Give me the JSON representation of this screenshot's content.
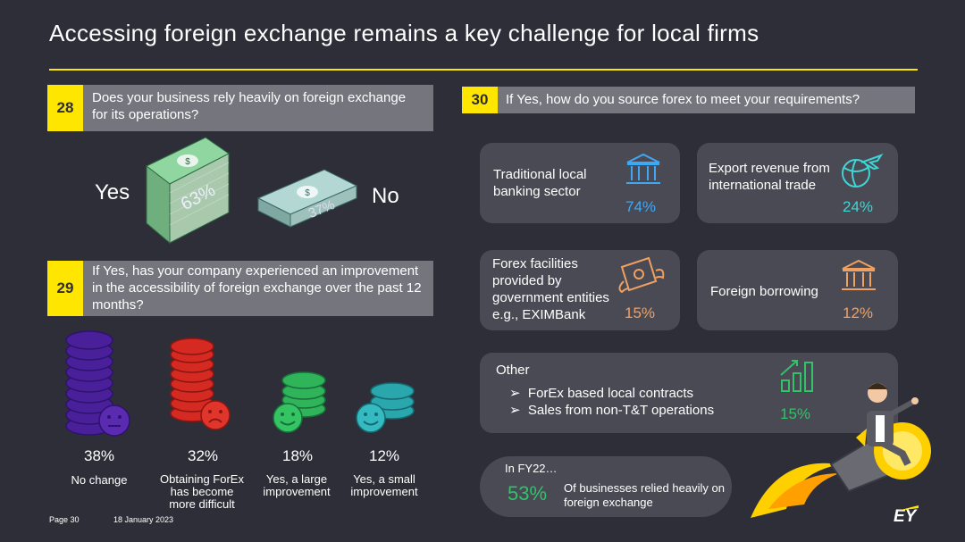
{
  "title": "Accessing foreign exchange remains a key challenge for local firms",
  "colors": {
    "background": "#2e2e38",
    "accent": "#ffe600",
    "bar": "#75757e",
    "card": "#4a4a54",
    "blue": "#3ea8f5",
    "teal": "#3fd5d5",
    "orange": "#f0a060",
    "green": "#31c26a"
  },
  "q28": {
    "number": "28",
    "text": "Does your business rely heavily on foreign exchange for its operations?",
    "yes_label": "Yes",
    "no_label": "No",
    "yes_pct": "63%",
    "no_pct": "37%"
  },
  "q29": {
    "number": "29",
    "text": "If Yes, has your company experienced an improvement in the accessibility of foreign exchange over the past 12 months?",
    "items": [
      {
        "pct": "38%",
        "label": "No change",
        "icon": "neutral-face-coins-icon",
        "color": "#5a2bb0"
      },
      {
        "pct": "32%",
        "label": "Obtaining ForEx has become more difficult",
        "icon": "sad-face-coins-icon",
        "color": "#e0352b"
      },
      {
        "pct": "18%",
        "label": "Yes, a large improvement",
        "icon": "smiley-face-coins-icon",
        "color": "#2fb45a"
      },
      {
        "pct": "12%",
        "label": "Yes, a small improvement",
        "icon": "smiley-face-coins-icon",
        "color": "#2aa7ad"
      }
    ]
  },
  "q30": {
    "number": "30",
    "text": "If Yes, how do you source forex to meet your requirements?",
    "cards": [
      {
        "label": "Traditional local banking sector",
        "pct": "74%",
        "icon": "bank-icon"
      },
      {
        "label": "Export revenue from international trade",
        "pct": "24%",
        "icon": "globe-plane-icon"
      },
      {
        "label": "Forex facilities provided by government entities e.g., EXIMBank",
        "pct": "15%",
        "icon": "flying-money-icon"
      },
      {
        "label": "Foreign borrowing",
        "pct": "12%",
        "icon": "bank-icon"
      }
    ],
    "other": {
      "title": "Other",
      "bullets": [
        "ForEx based local contracts",
        "Sales from non-T&T operations"
      ],
      "pct": "15%",
      "icon": "bar-chart-icon"
    }
  },
  "fy22": {
    "label": "In FY22…",
    "pct": "53%",
    "text": "Of businesses relied heavily on foreign exchange"
  },
  "footer": {
    "page": "Page 30",
    "date": "18 January 2023",
    "logo": "EY"
  }
}
